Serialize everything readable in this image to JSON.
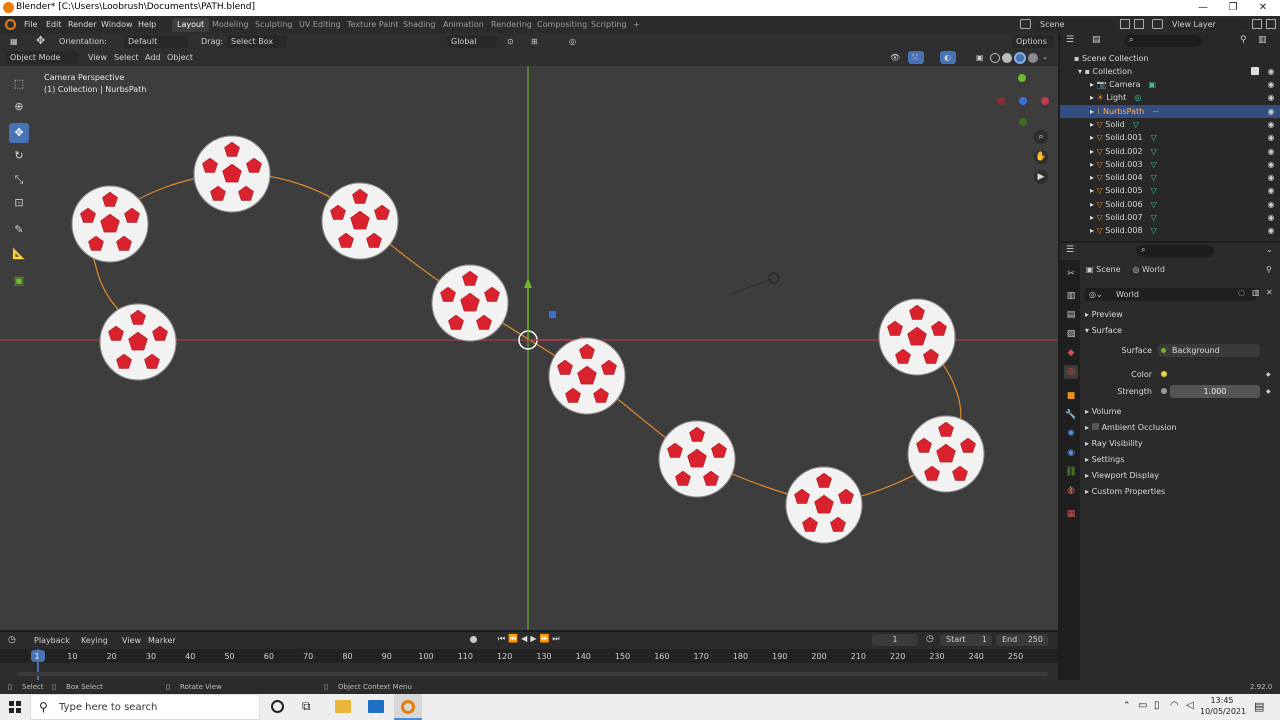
{
  "window": {
    "title": "Blender* [C:\\Users\\Loobrush\\Documents\\PATH.blend]",
    "min": "—",
    "max": "❐",
    "close": "✕"
  },
  "menu": {
    "file": "File",
    "edit": "Edit",
    "render": "Render",
    "window": "Window",
    "help": "Help"
  },
  "workspaces": [
    "Layout",
    "Modeling",
    "Sculpting",
    "UV Editing",
    "Texture Paint",
    "Shading",
    "Animation",
    "Rendering",
    "Compositing",
    "Scripting",
    "+"
  ],
  "scene": {
    "label": "Scene",
    "view_layer": "View Layer"
  },
  "header": {
    "orientation_label": "Orientation:",
    "orientation_value": "Default",
    "drag_label": "Drag:",
    "drag_value": "Select Box",
    "transform": "Global",
    "options": "Options"
  },
  "header2": {
    "mode": "Object Mode",
    "view": "View",
    "select": "Select",
    "add": "Add",
    "object": "Object"
  },
  "viewport": {
    "camera_text": "Camera Perspective",
    "collection_text": "(1) Collection | NurbsPath"
  },
  "outliner": {
    "root": "Scene Collection",
    "collection": "Collection",
    "items": [
      {
        "name": "Camera",
        "type": "camera"
      },
      {
        "name": "Light",
        "type": "light"
      },
      {
        "name": "NurbsPath",
        "type": "curve",
        "selected": true
      },
      {
        "name": "Solid",
        "type": "mesh"
      },
      {
        "name": "Solid.001",
        "type": "mesh"
      },
      {
        "name": "Solid.002",
        "type": "mesh"
      },
      {
        "name": "Solid.003",
        "type": "mesh"
      },
      {
        "name": "Solid.004",
        "type": "mesh"
      },
      {
        "name": "Solid.005",
        "type": "mesh"
      },
      {
        "name": "Solid.006",
        "type": "mesh"
      },
      {
        "name": "Solid.007",
        "type": "mesh"
      },
      {
        "name": "Solid.008",
        "type": "mesh"
      }
    ]
  },
  "properties": {
    "breadcrumb_scene": "Scene",
    "breadcrumb_world": "World",
    "world_name": "World",
    "preview": "Preview",
    "surface": "Surface",
    "surface_label": "Surface",
    "surface_value": "Background",
    "color_label": "Color",
    "strength_label": "Strength",
    "strength_value": "1.000",
    "volume": "Volume",
    "ambient_occlusion": "Ambient Occlusion",
    "ray_visibility": "Ray Visibility",
    "settings": "Settings",
    "viewport_display": "Viewport Display",
    "custom_properties": "Custom Properties"
  },
  "timeline": {
    "playback": "Playback",
    "keying": "Keying",
    "view": "View",
    "marker": "Marker",
    "current_frame": "1",
    "start_label": "Start",
    "start_value": "1",
    "end_label": "End",
    "end_value": "250",
    "ticks": [
      "1",
      "10",
      "20",
      "30",
      "40",
      "50",
      "60",
      "70",
      "80",
      "90",
      "100",
      "110",
      "120",
      "130",
      "140",
      "150",
      "160",
      "170",
      "180",
      "190",
      "200",
      "210",
      "220",
      "230",
      "240",
      "250"
    ]
  },
  "status": {
    "select": "Select",
    "box_select": "Box Select",
    "rotate_view": "Rotate View",
    "context_menu": "Object Context Menu",
    "version": "2.92.0"
  },
  "taskbar": {
    "search_placeholder": "Type here to search",
    "time": "13:45",
    "date": "10/05/2021"
  },
  "colors": {
    "accent": "#4772b3",
    "selection": "#334d80",
    "path": "#e08a2c",
    "x_axis": "#c23a4c",
    "y_axis": "#6fb82a",
    "ball_red": "#d9222d"
  }
}
